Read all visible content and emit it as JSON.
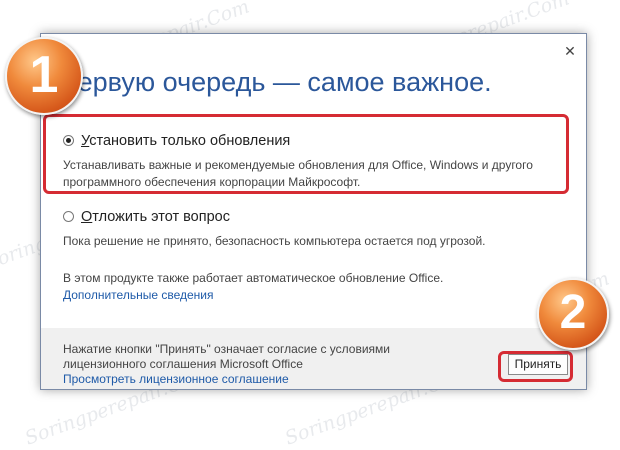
{
  "dialog": {
    "close_glyph": "✕",
    "heading_tail": "первую очередь — самое важное.",
    "option1": {
      "label_underlined": "У",
      "label_rest": "становить только обновления",
      "selected": true,
      "description": "Устанавливать важные и рекомендуемые обновления для Office, Windows и другого программного обеспечения корпорации Майкрософт."
    },
    "option2": {
      "label_underlined": "О",
      "label_rest": "тложить этот вопрос",
      "selected": false,
      "description": "Пока решение не принято, безопасность компьютера остается под угрозой."
    },
    "info_text": "В этом продукте также работает автоматическое обновление Office.",
    "more_link": "Дополнительные сведения",
    "footer": {
      "agreement_line1": "Нажатие кнопки \"Принять\" означает согласие с условиями",
      "agreement_line2": "лицензионного соглашения Microsoft Office",
      "license_link": "Просмотреть лицензионное соглашение",
      "accept_label": "Принять"
    }
  },
  "annotations": {
    "badge1": "1",
    "badge2": "2",
    "highlight_color": "#d52b33"
  },
  "watermark": "Soringperepair.Com",
  "colors": {
    "heading": "#2b579a",
    "link": "#1e5aa8",
    "badge": "#e0702a",
    "footer_bg": "#f0f0f0"
  }
}
